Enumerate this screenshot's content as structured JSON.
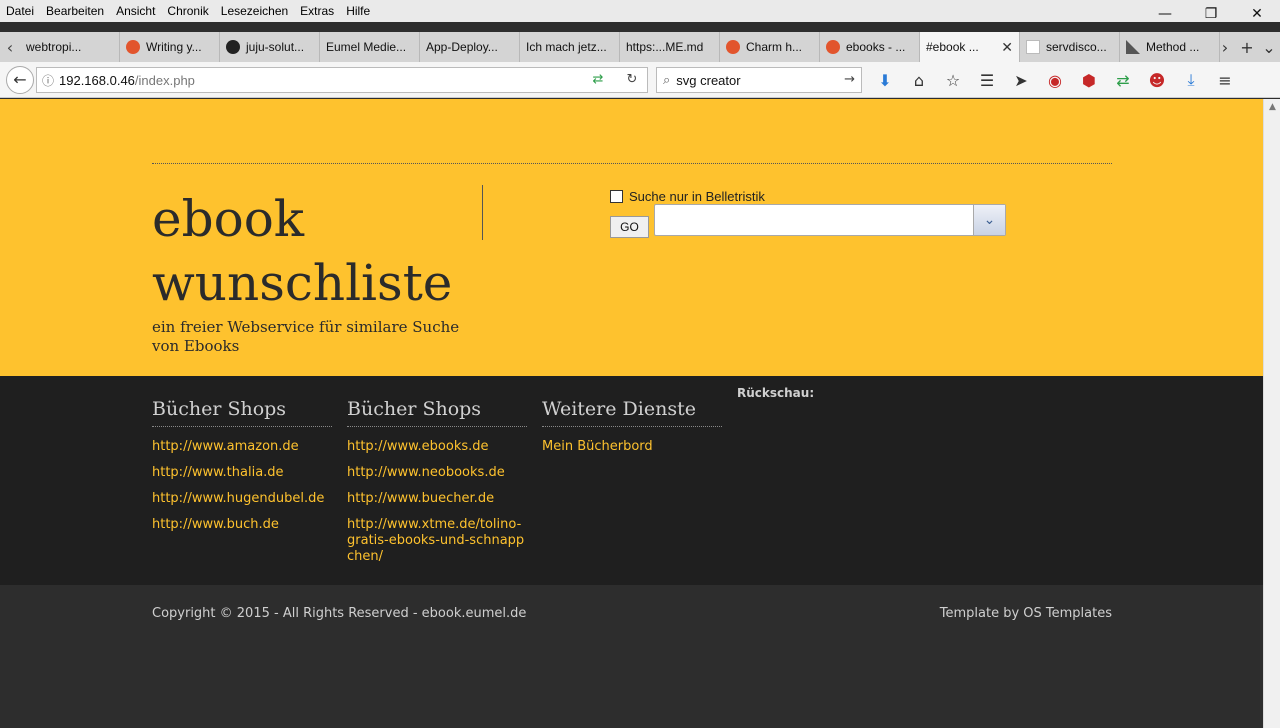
{
  "browser": {
    "menu": [
      "Datei",
      "Bearbeiten",
      "Ansicht",
      "Chronik",
      "Lesezeichen",
      "Extras",
      "Hilfe"
    ],
    "tabs": [
      {
        "label": "webtropi...",
        "icon": "none-icon"
      },
      {
        "label": "Writing y...",
        "icon": "orange-circle-icon"
      },
      {
        "label": "juju-solut...",
        "icon": "github-icon"
      },
      {
        "label": "Eumel Medie...",
        "icon": "none-icon"
      },
      {
        "label": "App-Deploy...",
        "icon": "none-icon"
      },
      {
        "label": "Ich mach jetz...",
        "icon": "none-icon"
      },
      {
        "label": "https:...ME.md",
        "icon": "none-icon"
      },
      {
        "label": "Charm h...",
        "icon": "orange-circle-icon"
      },
      {
        "label": "ebooks - ...",
        "icon": "orange-circle-icon"
      },
      {
        "label": "#ebook ...",
        "icon": "none-icon",
        "active": true
      },
      {
        "label": "servdisco...",
        "icon": "white-page-icon"
      },
      {
        "label": "Method ...",
        "icon": "gray-triangle-icon"
      }
    ],
    "url_host": "192.168.0.46",
    "url_path": "/index.php",
    "search_value": "svg creator"
  },
  "header": {
    "title": "ebook wunschliste",
    "tagline": "ein freier Webservice für similare Suche von Ebooks",
    "search": {
      "checkbox_label": "Suche nur in Belletristik",
      "checkbox_checked": false,
      "go_label": "GO",
      "combo_value": ""
    }
  },
  "footer": {
    "columns": [
      {
        "heading": "Bücher Shops",
        "links": [
          "http://www.amazon.de",
          "http://www.thalia.de",
          "http://www.hugendubel.de",
          "http://www.buch.de"
        ]
      },
      {
        "heading": "Bücher Shops",
        "links": [
          "http://www.ebooks.de",
          "http://www.neobooks.de",
          "http://www.buecher.de",
          "http://www.xtme.de/tolino-gratis-ebooks-und-schnappchen/"
        ]
      },
      {
        "heading": "Weitere Dienste",
        "links": [
          "Mein Bücherbord"
        ]
      }
    ],
    "rueckschau_label": "Rückschau:",
    "copyright": "Copyright © 2015 - All Rights Reserved - ebook.eumel.de",
    "template_credit": "Template by OS Templates"
  },
  "colors": {
    "header_bg": "#fec22e",
    "footer_bg": "#1f1f1f",
    "copyright_bg": "#2d2d2d",
    "link": "#fec22e"
  }
}
